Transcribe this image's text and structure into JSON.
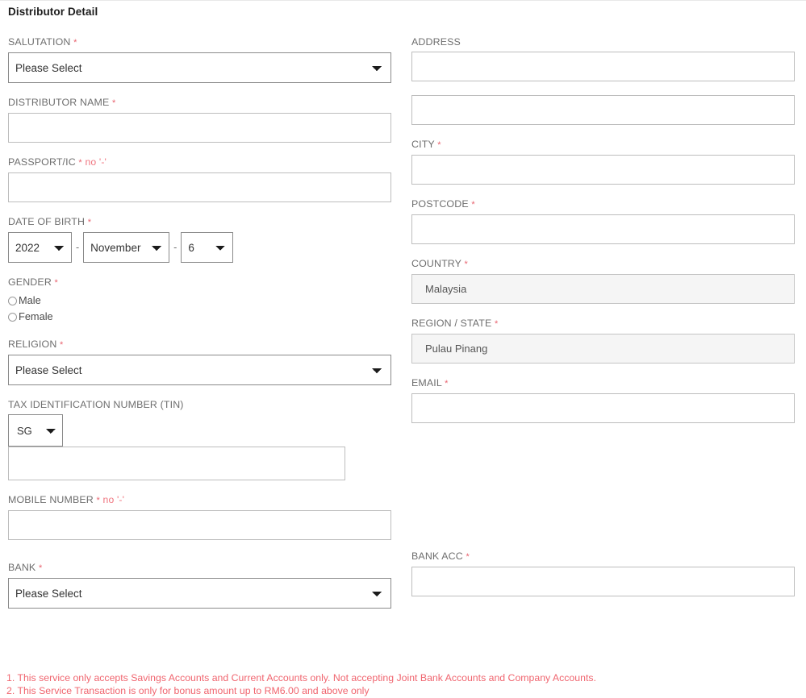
{
  "header": {
    "title": "Distributor Detail"
  },
  "symbols": {
    "required": "*",
    "dash": "-",
    "no_dash_hint": "no '-'"
  },
  "left_column": {
    "salutation": {
      "label": "SALUTATION",
      "required": true,
      "value": "Please Select"
    },
    "distributor_name": {
      "label": "DISTRIBUTOR NAME",
      "required": true,
      "value": ""
    },
    "passport_ic": {
      "label": "PASSPORT/IC",
      "required": true,
      "hint": "no '-'",
      "value": ""
    },
    "date_of_birth": {
      "label": "DATE OF BIRTH",
      "required": true,
      "year": "2022",
      "month": "November",
      "day": "6"
    },
    "gender": {
      "label": "GENDER",
      "required": true,
      "options": [
        {
          "label": "Male",
          "selected": false
        },
        {
          "label": "Female",
          "selected": false
        }
      ]
    },
    "religion": {
      "label": "RELIGION",
      "required": true,
      "value": "Please Select"
    },
    "tin": {
      "label": "TAX IDENTIFICATION NUMBER (TIN)",
      "required": false,
      "country_code": "SG",
      "value": ""
    },
    "mobile_number": {
      "label": "MOBILE NUMBER",
      "required": true,
      "hint": "no '-'",
      "value": ""
    },
    "bank": {
      "label": "BANK",
      "required": true,
      "value": "Please Select"
    }
  },
  "right_column": {
    "address": {
      "label": "ADDRESS",
      "required": false,
      "line1": "",
      "line2": ""
    },
    "city": {
      "label": "CITY",
      "required": true,
      "value": ""
    },
    "postcode": {
      "label": "POSTCODE",
      "required": true,
      "value": ""
    },
    "country": {
      "label": "COUNTRY",
      "required": true,
      "value": "Malaysia",
      "readonly": true
    },
    "region_state": {
      "label": "REGION / STATE",
      "required": true,
      "value": "Pulau Pinang",
      "readonly": true
    },
    "email": {
      "label": "EMAIL",
      "required": true,
      "value": ""
    },
    "bank_acc": {
      "label": "BANK ACC",
      "required": true,
      "value": ""
    }
  },
  "notes": [
    "1. This service only accepts Savings Accounts and Current Accounts only. Not accepting Joint Bank Accounts and Company Accounts.",
    "2. This Service Transaction is only for bonus amount up to RM6.00 and above only"
  ],
  "colors": {
    "required_red": "#e8636f",
    "note_red": "#f0656f",
    "label_grey": "#6e6e6e",
    "input_border": "#bdbdbd",
    "select_border": "#8a8a8a",
    "readonly_bg": "#f5f5f5"
  }
}
